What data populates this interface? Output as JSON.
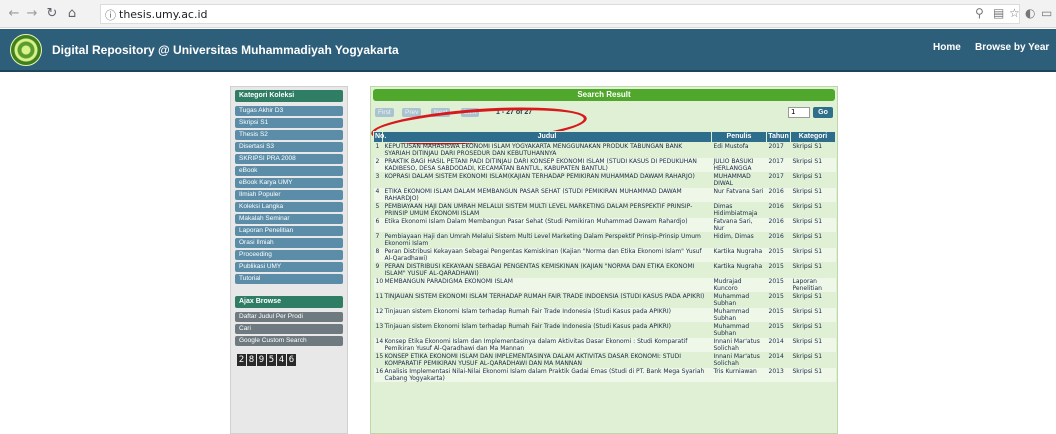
{
  "browser": {
    "url": "thesis.umy.ac.id"
  },
  "header": {
    "title": "Digital Repository @ Universitas Muhammadiyah Yogyakarta",
    "nav": [
      "Home",
      "Browse by Year"
    ]
  },
  "sidebar": {
    "heading": "Kategori Koleksi",
    "items": [
      "Tugas Akhir D3",
      "Skripsi S1",
      "Thesis S2",
      "Disertasi S3",
      "SKRIPSI PRA 2008",
      "eBook",
      "eBook Karya UMY",
      "Ilmiah Populer",
      "Koleksi Langka",
      "Makalah Seminar",
      "Laporan Penelitian",
      "Orasi Ilmiah",
      "Proceeding",
      "Publikasi UMY",
      "Tutorial"
    ],
    "ajax_heading": "Ajax Browse",
    "ajax_items": [
      "Daftar Judul Per Prodi",
      "Cari",
      "Google Custom Search"
    ],
    "counter": [
      "2",
      "8",
      "9",
      "5",
      "4",
      "6"
    ]
  },
  "results": {
    "heading": "Search Result",
    "pager": {
      "first": "First",
      "prev": "Prev",
      "next": "Next",
      "last": "Last",
      "range": "1 - 27 of 27",
      "page_value": "1",
      "go": "Go"
    },
    "columns": [
      "No.",
      "Judul",
      "Penulis",
      "Tahun",
      "Kategori"
    ],
    "rows": [
      {
        "no": "1",
        "judul": "KEPUTUSAN MAHASISWA EKONOMI ISLAM YOGYAKARTA MENGGUNAKAN PRODUK TABUNGAN BANK SYARIAH DITINJAU DARI PROSEDUR DAN KEBUTUHANNYA",
        "penulis": "Edi Mustofa",
        "tahun": "2017",
        "kategori": "Skripsi S1"
      },
      {
        "no": "2",
        "judul": "PRAKTIK BAGI HASIL PETANI PADI DITINJAU DARI KONSEP EKONOMI ISLAM (STUDI KASUS DI PEDUKUHAN KADIBESO, DESA SABDODADI, KECAMATAN BANTUL, KABUPATEN BANTUL)",
        "penulis": "JULIO BASUKI HERLANGGA",
        "tahun": "2017",
        "kategori": "Skripsi S1"
      },
      {
        "no": "3",
        "judul": "KOPRASI DALAM SISTEM EKONOMI ISLAM(KAJIAN TERHADAP PEMIKIRAN MUHAMMAD DAWAM RAHARJO)",
        "penulis": "MUHAMMAD DIWAL",
        "tahun": "2017",
        "kategori": "Skripsi S1"
      },
      {
        "no": "4",
        "judul": "ETIKA EKONOMI ISLAM DALAM MEMBANGUN PASAR SEHAT (STUDI PEMIKIRAN MUHAMMAD DAWAM RAHARDJO)",
        "penulis": "Nur Fatvana Sari",
        "tahun": "2016",
        "kategori": "Skripsi S1"
      },
      {
        "no": "5",
        "judul": "PEMBIAYAAN HAJI DAN UMRAH MELALUI SISTEM MULTI LEVEL MARKETING DALAM PERSPEKTIF PRINSIP-PRINSIP UMUM EKONOMI ISLAM",
        "penulis": "Dimas Hidimbiatmaja",
        "tahun": "2016",
        "kategori": "Skripsi S1"
      },
      {
        "no": "6",
        "judul": "Etika Ekonomi Islam Dalam Membangun Pasar Sehat (Studi Pemikiran Muhammad Dawam Rahardjo)",
        "penulis": "Fatvana Sari, Nur",
        "tahun": "2016",
        "kategori": "Skripsi S1"
      },
      {
        "no": "7",
        "judul": "Pembiayaan Haji dan Umrah Melalui Sistem Multi Level Marketing Dalam Perspektif Prinsip-Prinsip Umum Ekonomi Islam",
        "penulis": "Hidim, Dimas",
        "tahun": "2016",
        "kategori": "Skripsi S1"
      },
      {
        "no": "8",
        "judul": "Peran Distribusi Kekayaan Sebagai Pengentas Kemiskinan (Kajian \"Norma dan Etika Ekonomi Islam\" Yusuf Al-Qaradhawi)",
        "penulis": "Kartika Nugraha",
        "tahun": "2015",
        "kategori": "Skripsi S1"
      },
      {
        "no": "9",
        "judul": "PERAN DISTRIBUSI KEKAYAAN SEBAGAI PENGENTAS KEMISKINAN (KAJIAN \"NORMA DAN ETIKA EKONOMI ISLAM\" YUSUF AL-QARADHAWI)",
        "penulis": "Kartika Nugraha",
        "tahun": "2015",
        "kategori": "Skripsi S1"
      },
      {
        "no": "10",
        "judul": "MEMBANGUN PARADIGMA EKONOMI ISLAM",
        "penulis": "Mudrajad Kuncoro",
        "tahun": "2015",
        "kategori": "Laporan Penelitian"
      },
      {
        "no": "11",
        "judul": "TINJAUAN SISTEM EKONOMI ISLAM TERHADAP RUMAH FAIR TRADE INDOENSIA (STUDI KASUS PADA APIKRI)",
        "penulis": "Muhammad Subhan",
        "tahun": "2015",
        "kategori": "Skripsi S1"
      },
      {
        "no": "12",
        "judul": "Tinjauan sistem Ekonomi Islam terhadap Rumah Fair Trade Indonesia (Studi Kasus pada APIKRI)",
        "penulis": "Muhammad Subhan",
        "tahun": "2015",
        "kategori": "Skripsi S1"
      },
      {
        "no": "13",
        "judul": "Tinjauan sistem Ekonomi Islam terhadap Rumah Fair Trade Indonesia (Studi Kasus pada APIKRI)",
        "penulis": "Muhammad Subhan",
        "tahun": "2015",
        "kategori": "Skripsi S1"
      },
      {
        "no": "14",
        "judul": "Konsep Etika Ekonomi Islam dan Implementasinya dalam Aktivitas Dasar Ekonomi : Studi Komparatif Pemikiran Yusuf Al-Qaradhawi dan Ma Mannan",
        "penulis": "Innani Mar'atus Solichah",
        "tahun": "2014",
        "kategori": "Skripsi S1"
      },
      {
        "no": "15",
        "judul": "KONSEP ETIKA EKONOMI ISLAM DAN IMPLEMENTASINYA DALAM AKTIVITAS DASAR EKONOMI: STUDI KOMPARATIF PEMIKIRAN YUSUF AL-QARADHAWI DAN MA MANNAN",
        "penulis": "Innani Mar'atus Solichah",
        "tahun": "2014",
        "kategori": "Skripsi S1"
      },
      {
        "no": "16",
        "judul": "Analisis Implementasi Nilai-Nilai Ekonomi Islam dalam Praktik Gadai Emas (Studi di PT. Bank Mega Syariah Cabang Yogyakarta)",
        "penulis": "Tris Kurniawan",
        "tahun": "2013",
        "kategori": "Skripsi S1"
      }
    ]
  }
}
